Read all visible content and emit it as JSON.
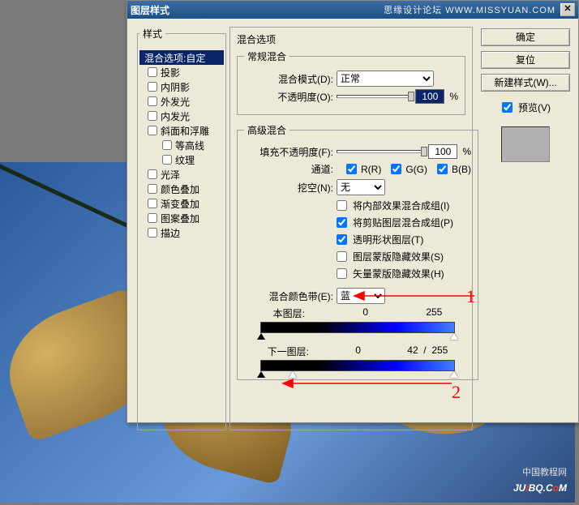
{
  "titlebar": {
    "title": "图层样式",
    "right_text": "思缘设计论坛  WWW.MISSYUAN.COM"
  },
  "styles_panel": {
    "legend": "样式",
    "items": [
      {
        "label": "混合选项:自定",
        "selected": true,
        "checkbox": false,
        "indent": false
      },
      {
        "label": "投影",
        "selected": false,
        "checkbox": true,
        "checked": false,
        "indent": false
      },
      {
        "label": "内阴影",
        "selected": false,
        "checkbox": true,
        "checked": false,
        "indent": false
      },
      {
        "label": "外发光",
        "selected": false,
        "checkbox": true,
        "checked": false,
        "indent": false
      },
      {
        "label": "内发光",
        "selected": false,
        "checkbox": true,
        "checked": false,
        "indent": false
      },
      {
        "label": "斜面和浮雕",
        "selected": false,
        "checkbox": true,
        "checked": false,
        "indent": false
      },
      {
        "label": "等高线",
        "selected": false,
        "checkbox": true,
        "checked": false,
        "indent": true
      },
      {
        "label": "纹理",
        "selected": false,
        "checkbox": true,
        "checked": false,
        "indent": true
      },
      {
        "label": "光泽",
        "selected": false,
        "checkbox": true,
        "checked": false,
        "indent": false
      },
      {
        "label": "颜色叠加",
        "selected": false,
        "checkbox": true,
        "checked": false,
        "indent": false
      },
      {
        "label": "渐变叠加",
        "selected": false,
        "checkbox": true,
        "checked": false,
        "indent": false
      },
      {
        "label": "图案叠加",
        "selected": false,
        "checkbox": true,
        "checked": false,
        "indent": false
      },
      {
        "label": "描边",
        "selected": false,
        "checkbox": true,
        "checked": false,
        "indent": false
      }
    ]
  },
  "options": {
    "section_title": "混合选项",
    "general": {
      "legend": "常规混合",
      "blend_mode_label": "混合模式(D):",
      "blend_mode_value": "正常",
      "opacity_label": "不透明度(O):",
      "opacity_value": "100",
      "opacity_unit": "%"
    },
    "advanced": {
      "legend": "高级混合",
      "fill_opacity_label": "填充不透明度(F):",
      "fill_opacity_value": "100",
      "fill_opacity_unit": "%",
      "channels_label": "通道:",
      "channel_r": "R(R)",
      "channel_g": "G(G)",
      "channel_b": "B(B)",
      "knockout_label": "挖空(N):",
      "knockout_value": "无",
      "chk_interior": "将内部效果混合成组(I)",
      "chk_clipped": "将剪贴图层混合成组(P)",
      "chk_trans": "透明形状图层(T)",
      "chk_mask_fx": "图层蒙版隐藏效果(S)",
      "chk_vec_fx": "矢量蒙版隐藏效果(H)",
      "chk_values": {
        "interior": false,
        "clipped": true,
        "trans": true,
        "mask_fx": false,
        "vec_fx": false
      }
    },
    "blendif": {
      "label": "混合颜色带(E):",
      "value": "蓝",
      "this_layer_label": "本图层:",
      "this_layer_low": "0",
      "this_layer_high": "255",
      "under_layer_label": "下一图层:",
      "under_layer_low": "0",
      "under_layer_split": "42",
      "under_layer_sep": "/",
      "under_layer_high": "255"
    }
  },
  "buttons": {
    "ok": "确定",
    "cancel": "复位",
    "new_style": "新建样式(W)...",
    "preview_label": "预览(V)"
  },
  "annotations": {
    "one": "1",
    "two": "2"
  },
  "watermarks": {
    "bottom_main_pre": "JU",
    "bottom_main_i": "i",
    "bottom_main_mid": "BQ.C",
    "bottom_main_o": "o",
    "bottom_main_post": "M",
    "bottom_small": "中国教程网"
  }
}
